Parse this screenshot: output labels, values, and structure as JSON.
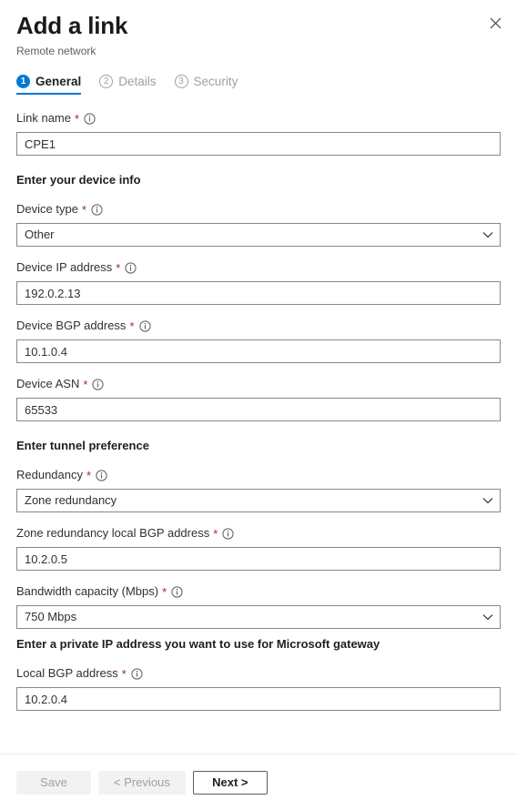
{
  "panel": {
    "title": "Add a link",
    "subtitle": "Remote network",
    "close_label": "×"
  },
  "tabs": [
    {
      "number": "1",
      "label": "General",
      "state": "active"
    },
    {
      "number": "2",
      "label": "Details",
      "state": "inactive"
    },
    {
      "number": "3",
      "label": "Security",
      "state": "inactive"
    }
  ],
  "form": {
    "link_name": {
      "label": "Link name",
      "required": "*",
      "value": "CPE1"
    },
    "device_section": {
      "heading": "Enter your device info"
    },
    "device_type": {
      "label": "Device type",
      "required": "*",
      "value": "Other"
    },
    "device_ip": {
      "label": "Device IP address",
      "required": "*",
      "value": "192.0.2.13"
    },
    "device_bgp": {
      "label": "Device BGP address",
      "required": "*",
      "value": "10.1.0.4"
    },
    "device_asn": {
      "label": "Device ASN",
      "required": "*",
      "value": "65533"
    },
    "tunnel_section": {
      "heading": "Enter tunnel preference"
    },
    "redundancy": {
      "label": "Redundancy",
      "required": "*",
      "value": "Zone redundancy"
    },
    "zone_local_bgp": {
      "label": "Zone redundancy local BGP address",
      "required": "*",
      "value": "10.2.0.5"
    },
    "bandwidth": {
      "label": "Bandwidth capacity (Mbps)",
      "required": "*",
      "value": "750 Mbps"
    },
    "gateway_section": {
      "heading": "Enter a private IP address you want to use for Microsoft gateway"
    },
    "local_bgp": {
      "label": "Local BGP address",
      "required": "*",
      "value": "10.2.0.4"
    }
  },
  "footer": {
    "save_label": "Save",
    "previous_label": "< Previous",
    "next_label": "Next >"
  },
  "colors": {
    "accent": "#0078d4",
    "required_star": "#a4262c",
    "border": "#8a8886",
    "disabled_text": "#a19f9d"
  },
  "icons": {
    "info": "info-icon",
    "close": "close-icon",
    "chevron": "chevron-down-icon"
  }
}
